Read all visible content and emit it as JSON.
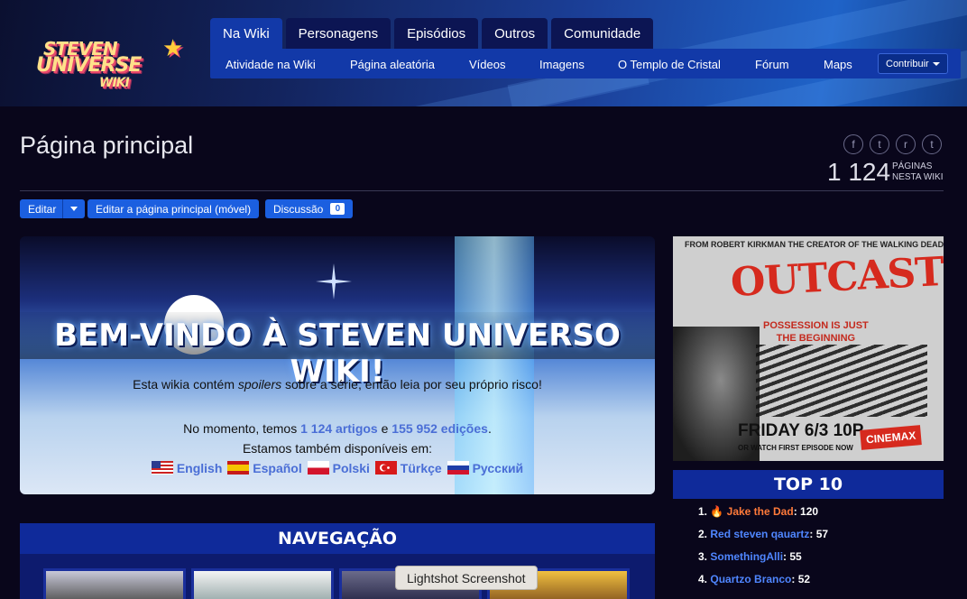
{
  "logo": {
    "line1": "STEVEN",
    "line2": "UNIVERSE",
    "line3": "WIKI"
  },
  "tabs": [
    "Na Wiki",
    "Personagens",
    "Episódios",
    "Outros",
    "Comunidade"
  ],
  "subnav": [
    "Atividade na Wiki",
    "Página aleatória",
    "Vídeos",
    "Imagens",
    "O Templo de Cristal",
    "Fórum",
    "Maps"
  ],
  "contribute_label": "Contribuir",
  "page": {
    "title": "Página principal",
    "count": "1 124",
    "count_label_1": "PÁGINAS",
    "count_label_2": "NESTA WIKI"
  },
  "social": {
    "facebook": "f",
    "twitter": "t",
    "reddit": "r",
    "tumblr": "t"
  },
  "buttons": {
    "edit": "Editar",
    "edit_mobile": "Editar a página principal (móvel)",
    "discussion": "Discussão",
    "discussion_count": "0"
  },
  "banner": {
    "welcome": "BEM-VINDO À STEVEN UNIVERSO WIKI!",
    "spoiler_pre": "Esta wikia contém ",
    "spoiler_em": "spoilers",
    "spoiler_post": " sobre a série, então leia por seu próprio risco!",
    "stats_pre": "No momento, temos ",
    "stats_articles": "1 124 artigos",
    "stats_mid": " e ",
    "stats_edits": "155 952 edições",
    "stats_post": ".",
    "available": "Estamos também disponíveis em:",
    "languages": [
      "English",
      "Español",
      "Polski",
      "Türkçe",
      "Русский"
    ]
  },
  "nav_heading": "NAVEGAÇÃO",
  "ad": {
    "top_line": "FROM ROBERT KIRKMAN THE CREATOR OF THE WALKING DEAD",
    "title": "OUTCAST",
    "tag_1": "POSSESSION IS JUST",
    "tag_2": "THE BEGINNING",
    "date": "FRIDAY 6/3 10P",
    "sub": "OR WATCH FIRST EPISODE NOW",
    "network": "CINEMAX"
  },
  "top10": {
    "heading": "TOP 10",
    "rows": [
      {
        "rank": "1.",
        "user": "Jake the Dad",
        "score": "120"
      },
      {
        "rank": "2.",
        "user": "Red steven qauartz",
        "score": "57"
      },
      {
        "rank": "3.",
        "user": "SomethingAlli",
        "score": "55"
      },
      {
        "rank": "4.",
        "user": "Quartzo Branco",
        "score": "52"
      }
    ]
  },
  "tooltip": "Lightshot Screenshot",
  "colors": {
    "background": "#09061b",
    "accent": "#1b5fe0",
    "header_bar": "#0f2a9a",
    "link": "#4a6ed6"
  }
}
